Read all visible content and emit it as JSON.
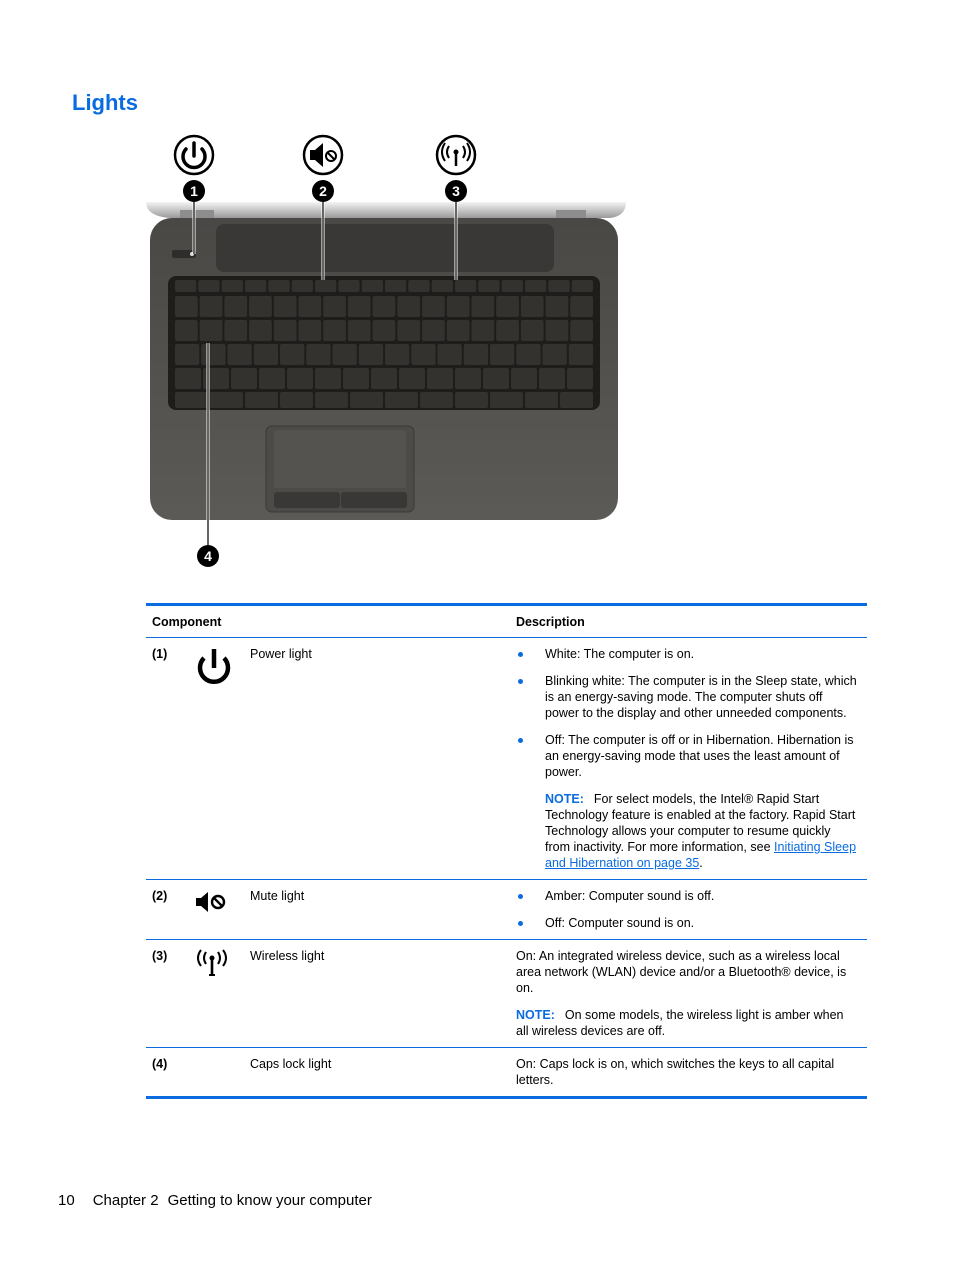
{
  "page": {
    "title": "Lights",
    "accent_color": "#0a6ce0"
  },
  "illustration": {
    "callouts": [
      {
        "number": "1",
        "icon": "power-icon"
      },
      {
        "number": "2",
        "icon": "mute-icon"
      },
      {
        "number": "3",
        "icon": "wireless-icon"
      },
      {
        "number": "4",
        "icon": null
      }
    ]
  },
  "table": {
    "headers": {
      "component": "Component",
      "description": "Description"
    },
    "rows": [
      {
        "num": "(1)",
        "icon": "power-icon",
        "name": "Power light",
        "bullets": [
          "White: The computer is on.",
          "Blinking white: The computer is in the Sleep state, which is an energy-saving mode. The computer shuts off power to the display and other unneeded components.",
          "Off: The computer is off or in Hibernation. Hibernation is an energy-saving mode that uses the least amount of power."
        ],
        "note_label": "NOTE:",
        "note_text": "For select models, the Intel® Rapid Start Technology feature is enabled at the factory. Rapid Start Technology allows your computer to resume quickly from inactivity. For more information, see ",
        "note_link": "Initiating Sleep and Hibernation on page 35",
        "note_end": "."
      },
      {
        "num": "(2)",
        "icon": "mute-icon",
        "name": "Mute light",
        "bullets": [
          "Amber: Computer sound is off.",
          "Off: Computer sound is on."
        ]
      },
      {
        "num": "(3)",
        "icon": "wireless-icon",
        "name": "Wireless light",
        "text": "On: An integrated wireless device, such as a wireless local area network (WLAN) device and/or a Bluetooth® device, is on.",
        "note_label": "NOTE:",
        "note_text": "On some models, the wireless light is amber when all wireless devices are off."
      },
      {
        "num": "(4)",
        "icon": null,
        "name": "Caps lock light",
        "text": "On: Caps lock is on, which switches the keys to all capital letters."
      }
    ]
  },
  "footer": {
    "page_number": "10",
    "chapter": "Chapter 2",
    "chapter_title": "Getting to know your computer"
  }
}
